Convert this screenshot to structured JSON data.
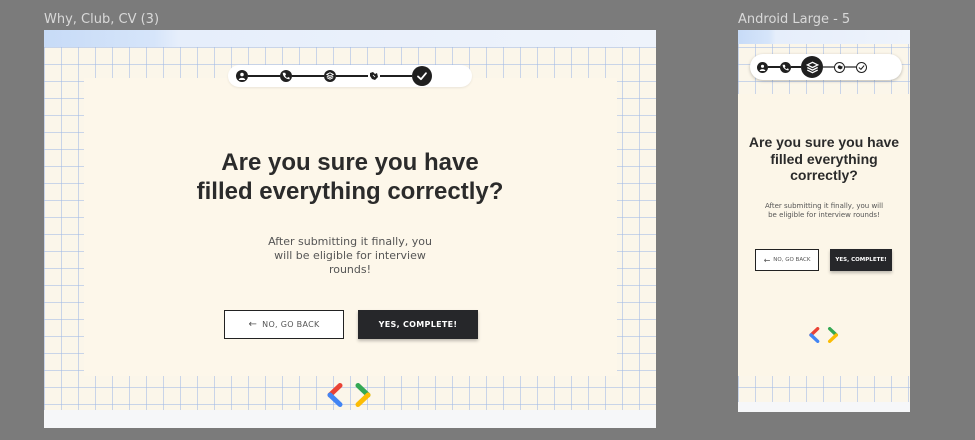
{
  "canvas": {
    "frames": [
      {
        "id": "desktop",
        "label": "Why, Club, CV (3)",
        "title": "Are you sure you have filled everything correctly?",
        "subtitle": "After submitting it finally, you will be eligible for interview rounds!",
        "back_button": "NO, GO BACK",
        "confirm_button": "YES, COMPLETE!"
      },
      {
        "id": "mobile",
        "label": "Android Large - 5",
        "title": "Are you sure you have filled everything correctly?",
        "subtitle": "After submitting it finally, you will be eligible for interview rounds!",
        "back_button": "NO, GO BACK",
        "confirm_button": "YES, COMPLETE!"
      }
    ]
  },
  "stepper_icons": [
    "user-icon",
    "phone-icon",
    "layers-icon",
    "handshake-icon",
    "check-icon"
  ],
  "colors": {
    "canvas": "#7b7b7b",
    "frame_bg": "#fbf6ea",
    "grid": "#a0b9e6",
    "button_dark": "#26272a",
    "logo_red": "#ea4335",
    "logo_blue": "#4285f4",
    "logo_green": "#34a853",
    "logo_yellow": "#fbbc04"
  }
}
